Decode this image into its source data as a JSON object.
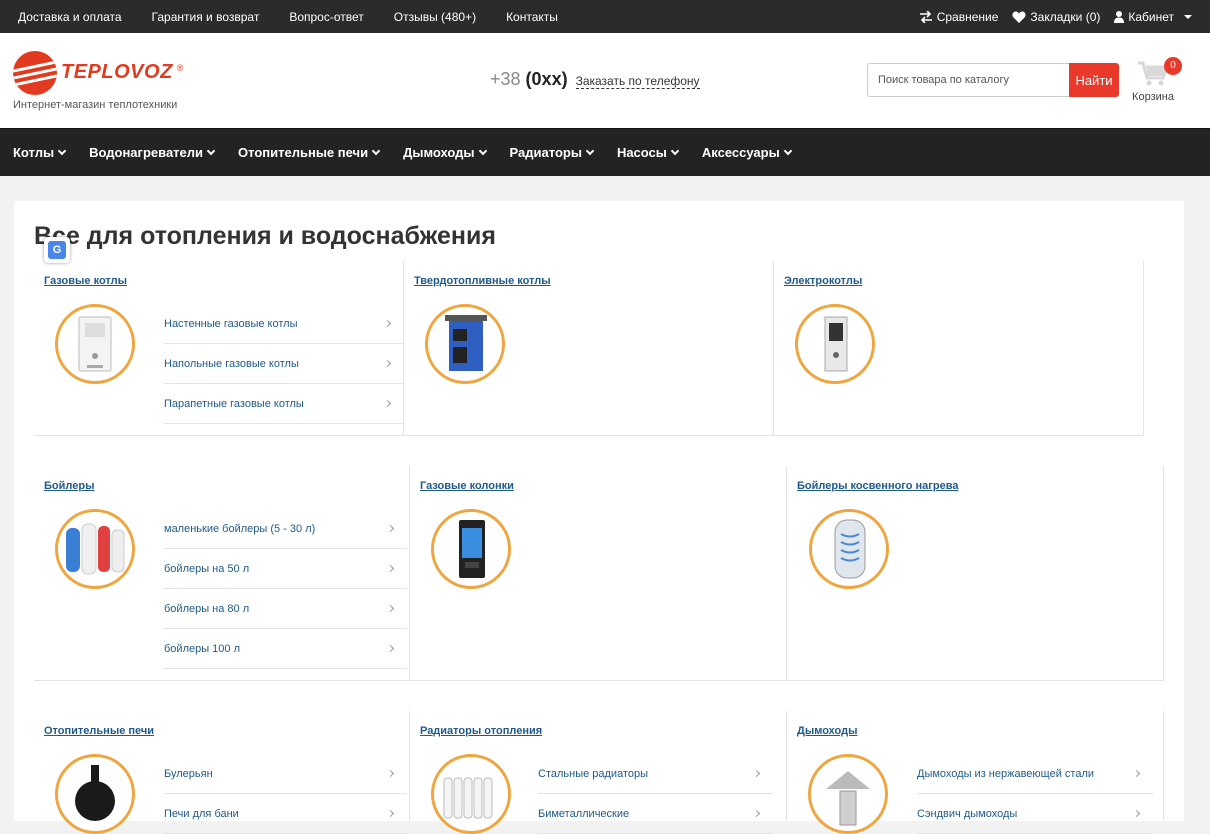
{
  "topbar": {
    "links": [
      "Доставка и оплата",
      "Гарантия и возврат",
      "Вопрос-ответ",
      "Отзывы (480+)",
      "Контакты"
    ],
    "compare": "Сравнение",
    "bookmarks": "Закладки (0)",
    "cabinet": "Кабинет"
  },
  "header": {
    "brand": "TEPLOVOZ",
    "reg": "®",
    "tagline": "Интернет-магазин теплотехники",
    "phone_prefix": "+38",
    "phone_code": "(0xx)",
    "call_link": "Заказать по телефону",
    "search_placeholder": "Поиск товара по каталогу",
    "search_button": "Найти",
    "cart_label": "Корзина",
    "cart_count": "0"
  },
  "nav": [
    "Котлы",
    "Водонагреватели",
    "Отопительные печи",
    "Дымоходы",
    "Радиаторы",
    "Насосы",
    "Аксессуары"
  ],
  "page": {
    "title": "Все для отопления и водоснабжения",
    "translate_icon": "G"
  },
  "categories": [
    {
      "name": "Газовые котлы",
      "icon": "wall-boiler-icon",
      "sub": [
        "Настенные газовые котлы",
        "Напольные газовые котлы",
        "Парапетные газовые котлы"
      ]
    },
    {
      "name": "Твердотопливные котлы",
      "icon": "solid-fuel-boiler-icon",
      "sub": []
    },
    {
      "name": "Электрокотлы",
      "icon": "electric-boiler-icon",
      "sub": []
    },
    {
      "name": "Бойлеры",
      "icon": "water-heaters-icon",
      "sub": [
        "маленькие бойлеры (5 - 30 л)",
        "бойлеры на 50 л",
        "бойлеры на 80 л",
        "бойлеры 100 л"
      ]
    },
    {
      "name": "Газовые колонки",
      "icon": "gas-water-heater-icon",
      "sub": []
    },
    {
      "name": "Бойлеры косвенного нагрева",
      "icon": "indirect-boiler-icon",
      "sub": []
    },
    {
      "name": "Отопительные печи",
      "icon": "stove-icon",
      "sub": [
        "Булерьян",
        "Печи для бани"
      ]
    },
    {
      "name": "Радиаторы отопления",
      "icon": "radiator-icon",
      "sub": [
        "Стальные радиаторы",
        "Биметаллические"
      ]
    },
    {
      "name": "Дымоходы",
      "icon": "chimney-icon",
      "sub": [
        "Дымоходы из нержавеющей стали",
        "Сэндвич дымоходы"
      ]
    }
  ]
}
